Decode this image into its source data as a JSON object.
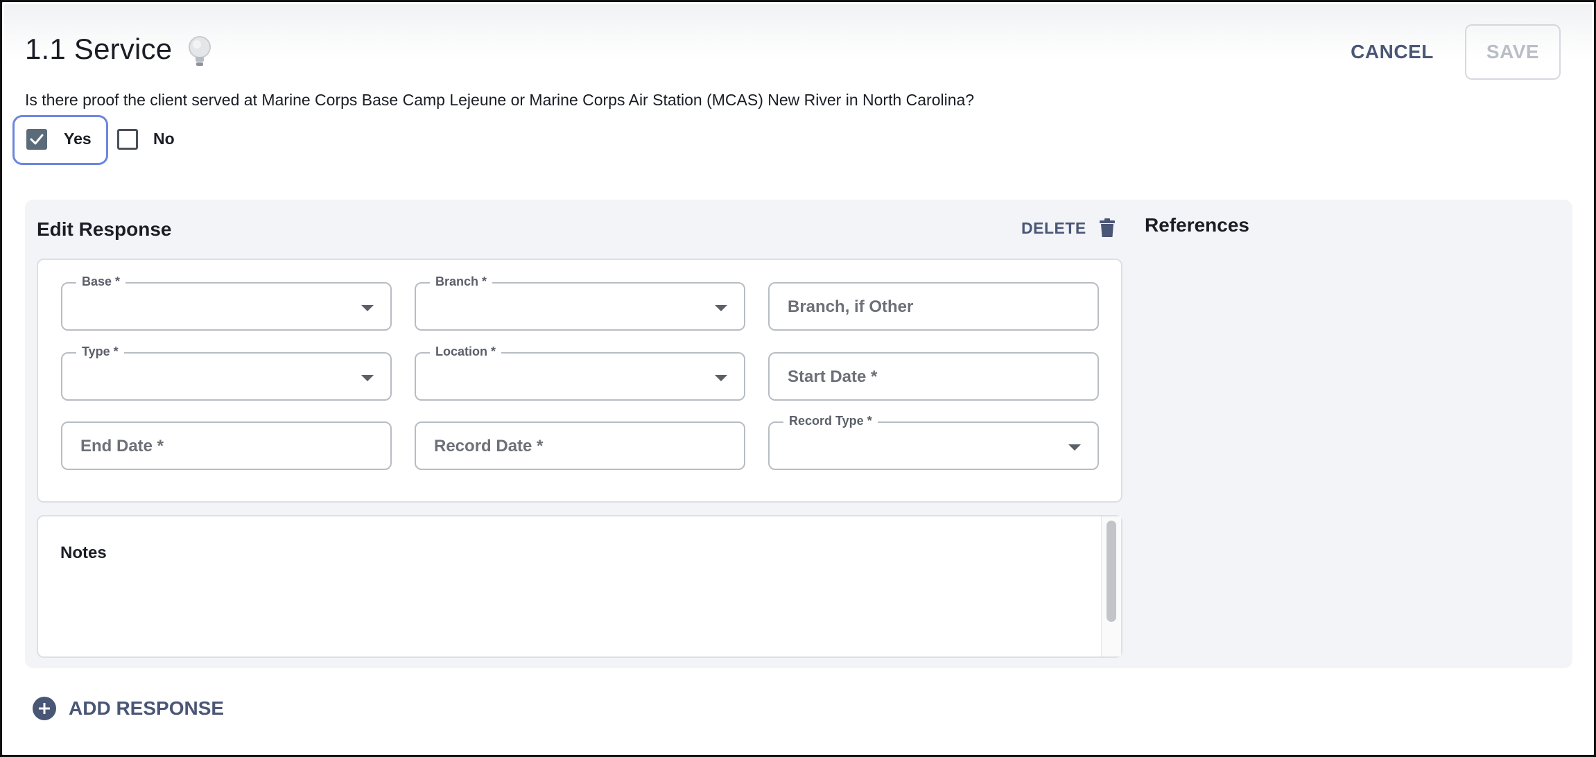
{
  "header": {
    "title": "1.1 Service",
    "hint_icon": "lightbulb-icon",
    "cancel_label": "CANCEL",
    "save_label": "SAVE"
  },
  "question": {
    "text": "Is there proof the client served at Marine Corps Base Camp Lejeune or Marine Corps Air Station (MCAS) New River in North Carolina?",
    "options": [
      {
        "label": "Yes",
        "checked": true
      },
      {
        "label": "No",
        "checked": false
      }
    ]
  },
  "edit_response": {
    "title": "Edit Response",
    "delete_label": "DELETE",
    "delete_icon": "trash-icon",
    "fields": {
      "base": {
        "label": "Base *",
        "type": "select",
        "value": ""
      },
      "branch": {
        "label": "Branch *",
        "type": "select",
        "value": ""
      },
      "branch_other": {
        "placeholder": "Branch, if Other",
        "type": "text"
      },
      "type": {
        "label": "Type *",
        "type": "select",
        "value": ""
      },
      "location": {
        "label": "Location *",
        "type": "select",
        "value": ""
      },
      "start_date": {
        "placeholder": "Start Date *",
        "type": "text"
      },
      "end_date": {
        "placeholder": "End Date *",
        "type": "text"
      },
      "record_date": {
        "placeholder": "Record Date *",
        "type": "text"
      },
      "record_type": {
        "label": "Record Type *",
        "type": "select",
        "value": ""
      }
    },
    "notes_label": "Notes"
  },
  "references": {
    "title": "References"
  },
  "footer": {
    "add_response_label": "ADD RESPONSE",
    "add_icon": "plus-circle-icon"
  },
  "colors": {
    "accent": "#4a5675",
    "focus_ring": "#6d86e0",
    "checkbox_checked": "#5c6b7a",
    "panel_bg": "#f3f4f7"
  }
}
